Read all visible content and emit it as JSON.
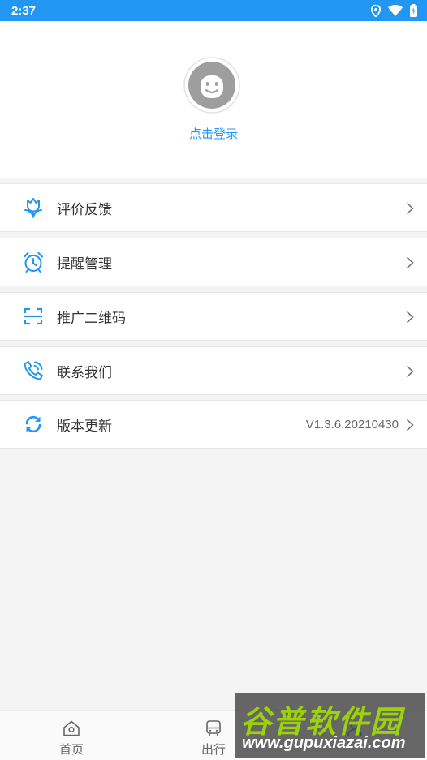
{
  "status_bar": {
    "time": "2:37",
    "icons": [
      "location-icon",
      "wifi-icon",
      "battery-icon"
    ]
  },
  "profile": {
    "avatar_icon": "smiley-avatar-icon",
    "login_label": "点击登录"
  },
  "menu": [
    {
      "label": "评价反馈",
      "icon": "tulip-feedback-icon",
      "value": ""
    },
    {
      "label": "提醒管理",
      "icon": "alarm-clock-icon",
      "value": ""
    },
    {
      "label": "推广二维码",
      "icon": "scan-qr-icon",
      "value": ""
    },
    {
      "label": "联系我们",
      "icon": "phone-call-icon",
      "value": ""
    },
    {
      "label": "版本更新",
      "icon": "refresh-icon",
      "value": "V1.3.6.20210430"
    }
  ],
  "tabbar": [
    {
      "label": "首页",
      "icon": "home-icon",
      "active": false
    },
    {
      "label": "出行",
      "icon": "bus-icon",
      "active": false
    },
    {
      "label": "",
      "icon": "user-icon",
      "active": true
    }
  ],
  "colors": {
    "accent": "#2196f3",
    "background": "#f4f4f4",
    "text": "#333333"
  },
  "watermark": {
    "title": "谷普软件园",
    "url": "www.gupuxiazai.com"
  }
}
